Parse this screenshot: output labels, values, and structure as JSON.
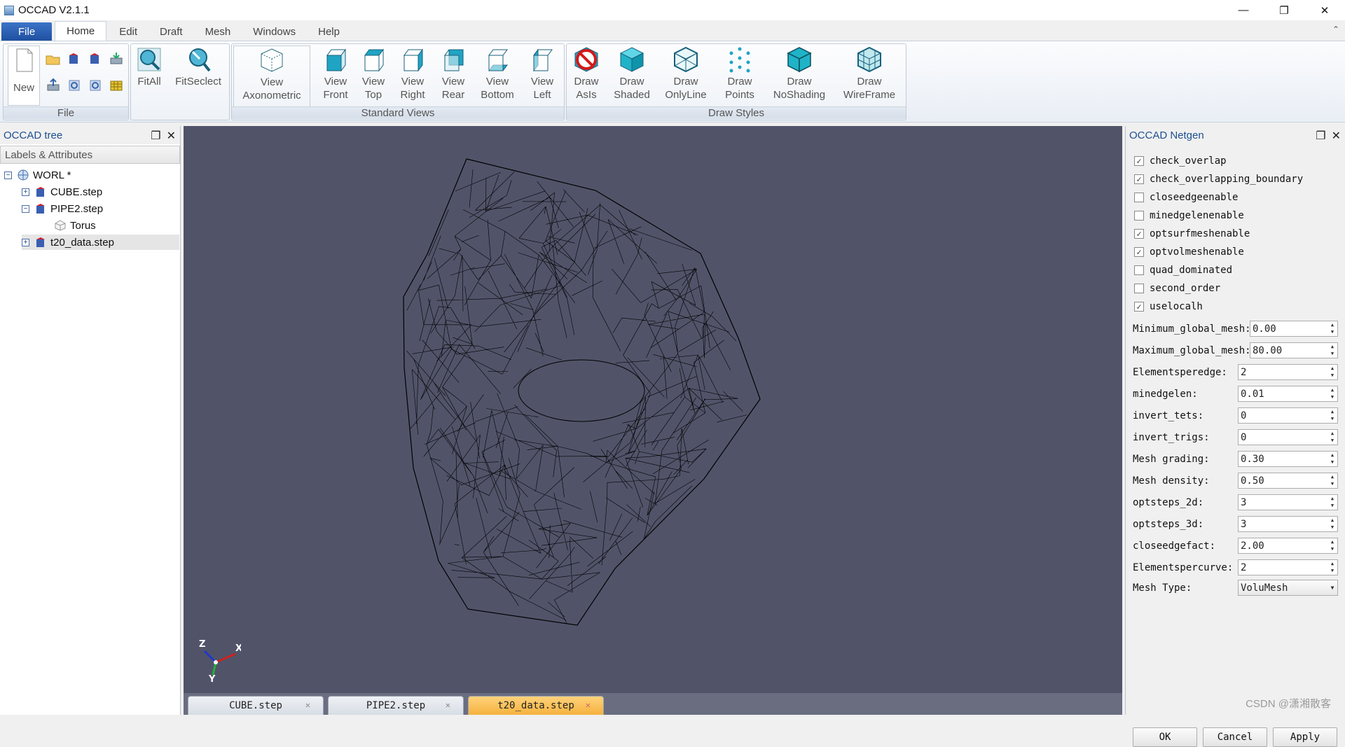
{
  "window": {
    "title": "OCCAD V2.1.1",
    "minimize": "—",
    "restore": "❐",
    "close": "✕"
  },
  "menu": {
    "items": [
      "File",
      "Home",
      "Edit",
      "Draft",
      "Mesh",
      "Windows",
      "Help"
    ],
    "collapse": "⌃"
  },
  "ribbon": {
    "file_group": {
      "label": "File",
      "new_label": "New"
    },
    "fit_group": {
      "fitall_label": "FitAll",
      "fitselect_label": "FitSeclect"
    },
    "views_group": {
      "label": "Standard Views",
      "axonometric": [
        "View",
        "Axonometric"
      ],
      "front": [
        "View",
        "Front"
      ],
      "top": [
        "View",
        "Top"
      ],
      "right": [
        "View",
        "Right"
      ],
      "rear": [
        "View",
        "Rear"
      ],
      "bottom": [
        "View",
        "Bottom"
      ],
      "left": [
        "View",
        "Left"
      ]
    },
    "draw_group": {
      "label": "Draw Styles",
      "asis": [
        "Draw",
        "AsIs"
      ],
      "shaded": [
        "Draw",
        "Shaded"
      ],
      "onlyline": [
        "Draw",
        "OnlyLine"
      ],
      "points": [
        "Draw",
        "Points"
      ],
      "noshading": [
        "Draw",
        "NoShading"
      ],
      "wireframe": [
        "Draw",
        "WireFrame"
      ]
    }
  },
  "tree_panel": {
    "title": "OCCAD tree",
    "header": "Labels & Attributes",
    "items": [
      {
        "label": "WORL *",
        "expander": "−"
      },
      {
        "label": "CUBE.step",
        "expander": "+"
      },
      {
        "label": "PIPE2.step",
        "expander": "−"
      },
      {
        "label": "Torus",
        "expander": ""
      },
      {
        "label": "t20_data.step",
        "expander": "+"
      }
    ]
  },
  "viewport": {
    "axis_z": "Z",
    "axis_x": "X",
    "axis_y": "Y"
  },
  "doc_tabs": [
    "CUBE.step",
    "PIPE2.step",
    "t20_data.step"
  ],
  "netgen_panel": {
    "title": "OCCAD Netgen",
    "checkboxes": [
      {
        "label": "check_overlap",
        "checked": true
      },
      {
        "label": "check_overlapping_boundary",
        "checked": true
      },
      {
        "label": "closeedgeenable",
        "checked": false
      },
      {
        "label": "minedgelenenable",
        "checked": false
      },
      {
        "label": "optsurfmeshenable",
        "checked": true
      },
      {
        "label": "optvolmeshenable",
        "checked": true
      },
      {
        "label": "quad_dominated",
        "checked": false
      },
      {
        "label": "second_order",
        "checked": false
      },
      {
        "label": "uselocalh",
        "checked": true
      }
    ],
    "params": [
      {
        "label": "Minimum_global_mesh:",
        "value": "0.00"
      },
      {
        "label": "Maximum_global_mesh:",
        "value": "80.00"
      },
      {
        "label": "Elementsperedge:",
        "value": "2"
      },
      {
        "label": "minedgelen:",
        "value": "0.01"
      },
      {
        "label": "invert_tets:",
        "value": "0"
      },
      {
        "label": "invert_trigs:",
        "value": "0"
      },
      {
        "label": "Mesh grading:",
        "value": "0.30"
      },
      {
        "label": "Mesh density:",
        "value": "0.50"
      },
      {
        "label": "optsteps_2d:",
        "value": "3"
      },
      {
        "label": "optsteps_3d:",
        "value": "3"
      },
      {
        "label": "closeedgefact:",
        "value": "2.00"
      },
      {
        "label": "Elementspercurve:",
        "value": "2"
      }
    ],
    "mesh_type": {
      "label": "Mesh Type:",
      "value": "VoluMesh"
    },
    "buttons": {
      "ok": "OK",
      "cancel": "Cancel",
      "apply": "Apply"
    }
  },
  "watermark": "CSDN @潇湘散客"
}
